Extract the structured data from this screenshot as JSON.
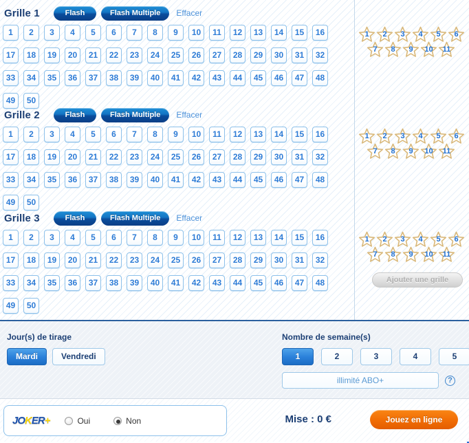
{
  "grilles": [
    {
      "title": "Grille 1",
      "flash_label": "Flash",
      "flash_multiple_label": "Flash Multiple",
      "clear_label": "Effacer"
    },
    {
      "title": "Grille 2",
      "flash_label": "Flash",
      "flash_multiple_label": "Flash Multiple",
      "clear_label": "Effacer"
    },
    {
      "title": "Grille 3",
      "flash_label": "Flash",
      "flash_multiple_label": "Flash Multiple",
      "clear_label": "Effacer"
    }
  ],
  "numbers": [
    1,
    2,
    3,
    4,
    5,
    6,
    7,
    8,
    9,
    10,
    11,
    12,
    13,
    14,
    15,
    16,
    17,
    18,
    19,
    20,
    21,
    22,
    23,
    24,
    25,
    26,
    27,
    28,
    29,
    30,
    31,
    32,
    33,
    34,
    35,
    36,
    37,
    38,
    39,
    40,
    41,
    42,
    43,
    44,
    45,
    46,
    47,
    48,
    49,
    50
  ],
  "stars_row1": [
    1,
    2,
    3,
    4,
    5,
    6
  ],
  "stars_row2": [
    7,
    8,
    9,
    10,
    11
  ],
  "add_grille_label": "Ajouter une grille",
  "options": {
    "days_label": "Jour(s) de tirage",
    "days": [
      {
        "label": "Mardi",
        "selected": true
      },
      {
        "label": "Vendredi",
        "selected": false
      }
    ],
    "weeks_label": "Nombre de semaine(s)",
    "weeks": [
      {
        "label": "1",
        "selected": true
      },
      {
        "label": "2",
        "selected": false
      },
      {
        "label": "3",
        "selected": false
      },
      {
        "label": "4",
        "selected": false
      },
      {
        "label": "5",
        "selected": false
      }
    ],
    "abo_label": "illimité ABO+",
    "help_label": "?"
  },
  "joker": {
    "logo_parts": [
      {
        "text": "JO",
        "color": "blue"
      },
      {
        "text": "K",
        "color": "yellow"
      },
      {
        "text": "ER",
        "color": "blue"
      },
      {
        "text": "+",
        "color": "yellow"
      }
    ],
    "yes_label": "Oui",
    "no_label": "Non",
    "yes_selected": false,
    "no_selected": true
  },
  "footer": {
    "stake_label": "Mise : 0 €",
    "play_label": "Jouez en ligne"
  },
  "colors": {
    "accent_blue": "#1b6cc4",
    "title_blue": "#1c3f74",
    "cell_blue": "#2e7cd6",
    "star_gold": "#d9b87a",
    "play_orange": "#f26f06"
  }
}
